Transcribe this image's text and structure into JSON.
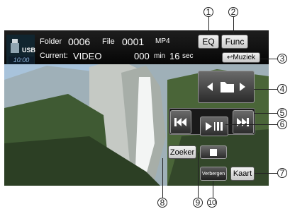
{
  "status": {
    "usb_label": "USB",
    "clock": "10:00",
    "folder_label": "Folder",
    "folder_value": "0006",
    "file_label": "File",
    "file_value": "0001",
    "format": "MP4",
    "current_label": "Current:",
    "current_value": "VIDEO",
    "time_min_value": "000",
    "time_min_unit": "min",
    "time_sec_value": "16",
    "time_sec_unit": "sec"
  },
  "buttons": {
    "eq": "EQ",
    "func": "Func",
    "muziek": "↩Muziek",
    "zoeker": "Zoeker",
    "verbergen": "Verbergen",
    "kaart": "Kaart"
  },
  "callouts": [
    "1",
    "2",
    "3",
    "4",
    "5",
    "6",
    "7",
    "8",
    "9",
    "10"
  ]
}
